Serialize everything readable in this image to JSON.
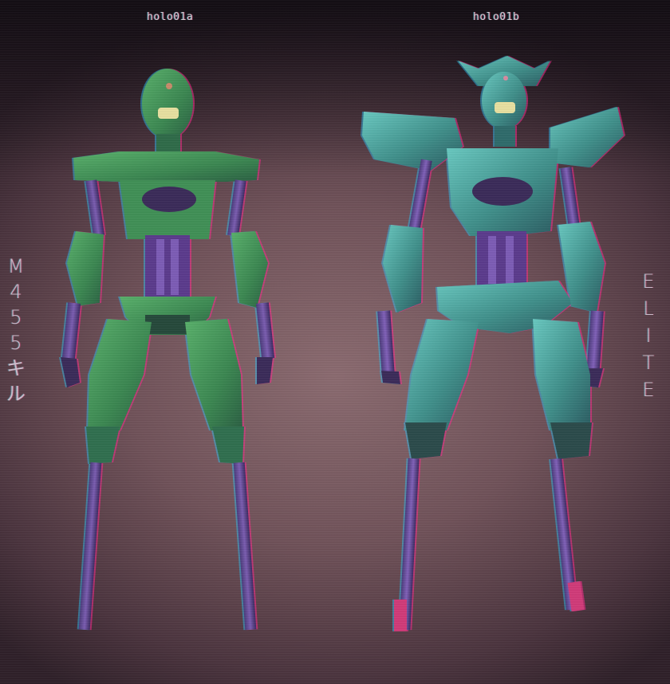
{
  "labels": {
    "left_model": "holo01a",
    "right_model": "holo01b"
  },
  "side_text": {
    "left": [
      "M",
      "4",
      "5",
      "5",
      "キ",
      "ル"
    ],
    "right": [
      "E",
      "L",
      "I",
      "T",
      "E"
    ]
  },
  "colors": {
    "robot_a_body": "#3f8f55",
    "robot_b_body": "#3f8f8a",
    "limb": "#5a3a8c",
    "background_center": "#8a6a6f",
    "background_edge": "#2e1f28"
  }
}
